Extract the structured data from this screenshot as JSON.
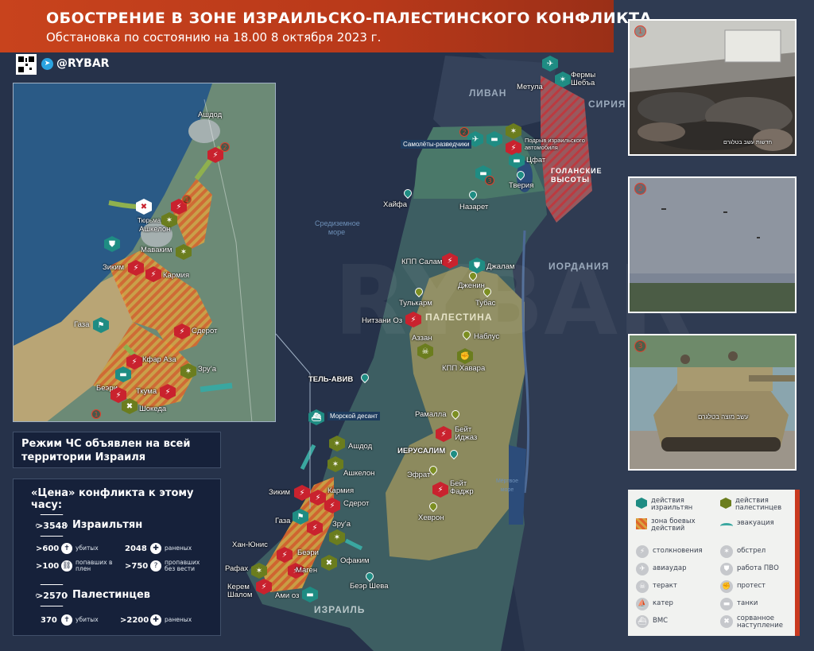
{
  "header": {
    "title": "ОБОСТРЕНИЕ В ЗОНЕ ИЗРАИЛЬСКО-ПАЛЕСТИНСКОГО КОНФЛИКТА",
    "subtitle": "Обстановка по состоянию на 18.00 8 октября 2023 г.",
    "brand": "@RYBAR"
  },
  "countries": {
    "lebanon": "ЛИВАН",
    "syria": "СИРИЯ",
    "jordan": "ИОРДАНИЯ",
    "palestine": "ПАЛЕСТИНА",
    "israel": "ИЗРАИЛЬ",
    "golan": "ГОЛАНСКИЕ ВЫСОТЫ"
  },
  "seas": {
    "med": "Средиземное море",
    "dead": "Мёртвое море"
  },
  "places": {
    "metula": "Метула",
    "shebaa": "Фермы Шебъа",
    "scouts": "Самолёты-разведчики",
    "blast": "Подрыв израильского автомобиля",
    "tsfat": "Цфат",
    "haifa": "Хайфа",
    "nazareth": "Назарет",
    "tiberias": "Тверия",
    "salam": "КПП Салам",
    "jalam": "Джалам",
    "jenin": "Дженин",
    "tulkarm": "Тулькарм",
    "tubas": "Тубас",
    "nitzani": "Нитзани Оз",
    "azzan": "Аззан",
    "nablus": "Наблус",
    "havara": "КПП Хавара",
    "telaviv": "ТЕЛЬ-АВИВ",
    "naval": "Морской десант",
    "ramallah": "Рамалла",
    "beit_ijaz": "Бейт Иджаз",
    "jerusalem": "ИЕРУСАЛИМ",
    "efrat": "Эфрат",
    "beit_fajar": "Бейт Фаджр",
    "hebron": "Хеврон",
    "ashdod": "Ашдод",
    "ashkelon": "Ашкелон",
    "zikim": "Зиким",
    "karmia": "Кармия",
    "sderot": "Сдерот",
    "gaza": "Газа",
    "khan_yunis": "Хан-Юнис",
    "rafah": "Рафах",
    "kerem_shalom": "Керем Шалом",
    "beeri": "Беэри",
    "zrua": "Зру’а",
    "magen": "Маген",
    "ofakim": "Офаким",
    "ami_oz": "Ами оз",
    "beer_sheva": "Беэр Шева"
  },
  "inset": {
    "ashdod": "Ашдод",
    "prison": "Тюрьма",
    "ashkelon": "Ашкелон",
    "mavakim": "Маваким",
    "zikim": "Зиким",
    "karmia": "Кармия",
    "gaza": "Газа",
    "sderot": "Сдерот",
    "kfar_aza": "Кфар Аза",
    "zrua": "Зру’а",
    "beeri": "Беэри",
    "tkuma": "Ткума",
    "shokeda": "Шокеда"
  },
  "notice": "Режим ЧС объявлен на всей территории Израиля",
  "price": {
    "title": "«Цена» конфликта к этому часу:",
    "israel_total": ">3548",
    "israel_label": "Израильтян",
    "isr_killed_n": ">600",
    "isr_killed_t": "убитых",
    "isr_wounded_n": "2048",
    "isr_wounded_t": "раненых",
    "isr_captive_n": ">100",
    "isr_captive_t": "попавших в плен",
    "isr_missing_n": ">750",
    "isr_missing_t": "пропавших без вести",
    "pal_total": ">2570",
    "pal_label": "Палестинцев",
    "pal_killed_n": "370",
    "pal_killed_t": "убитых",
    "pal_wounded_n": ">2200",
    "pal_wounded_t": "раненых"
  },
  "photos": {
    "n1": "1",
    "n2": "2",
    "n3": "3",
    "caption1": "חדשות עשב בטלגרם",
    "caption3": "עשב מוצה בטלגרם"
  },
  "legend": {
    "isr_actions": "действия израильтян",
    "pal_actions": "действия палестинцев",
    "combat_zone": "зона боевых действий",
    "evacuation": "эвакуация",
    "clash": "столкновения",
    "shelling": "обстрел",
    "airstrike": "авиаудар",
    "air_defense": "работа ПВО",
    "terror": "теракт",
    "protest": "протест",
    "boat": "катер",
    "tanks": "танки",
    "navy": "ВМС",
    "failed": "сорванное наступление"
  },
  "colors": {
    "israel": "#1f8c83",
    "palestine": "#6b7d1e",
    "clash": "#c9222e",
    "accent": "#c8431d"
  }
}
